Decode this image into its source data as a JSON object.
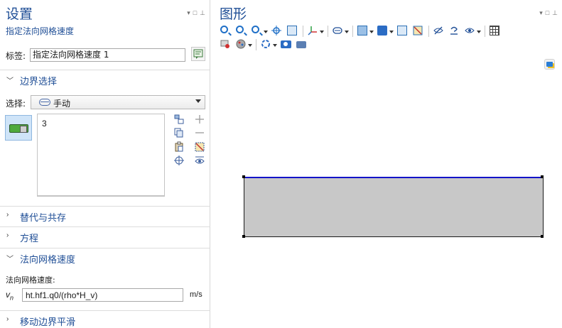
{
  "settings": {
    "title": "设置",
    "subtitle": "指定法向网格速度",
    "label": {
      "caption": "标签:",
      "value": "指定法向网格速度 1"
    },
    "sections": {
      "boundary": "边界选择",
      "override": "替代与共存",
      "equation": "方程",
      "normal_mesh_velocity": "法向网格速度",
      "smoothing": "移动边界平滑"
    },
    "selection": {
      "caption": "选择:",
      "mode": "手动",
      "items": [
        "3"
      ]
    },
    "velocity": {
      "caption": "法向网格速度:",
      "symbol": "v",
      "subscript": "n",
      "expression": "ht.hf1.q0/(rho*H_v)",
      "unit": "m/s"
    }
  },
  "graphics": {
    "title": "图形"
  }
}
